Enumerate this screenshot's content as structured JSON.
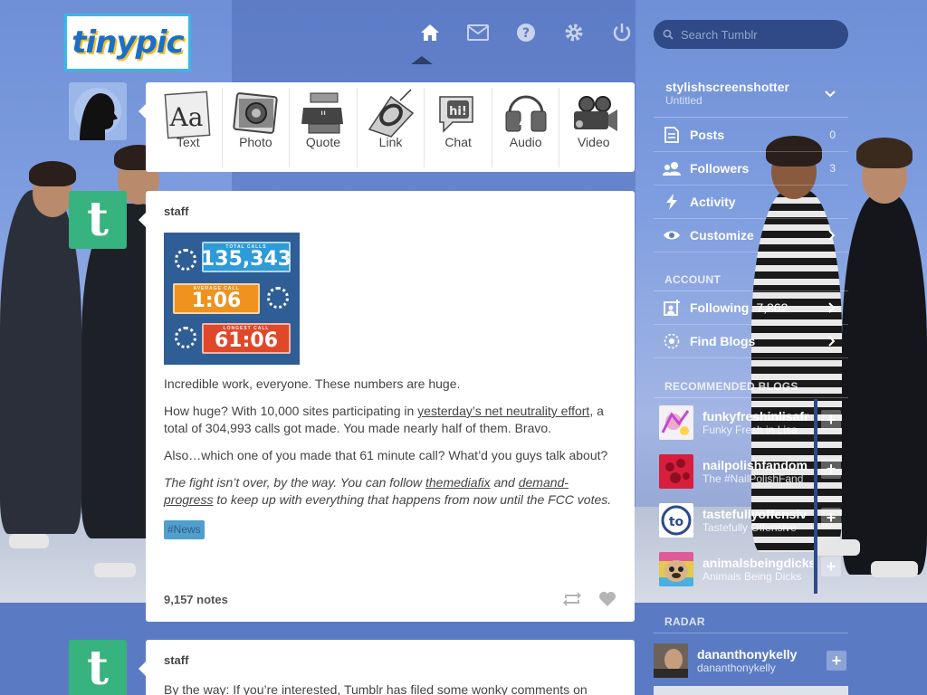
{
  "header": {
    "logo": "tinypic",
    "search_placeholder": "Search Tumblr",
    "nav": [
      "home-icon",
      "inbox-icon",
      "help-icon",
      "settings-icon",
      "logout-icon"
    ]
  },
  "postbox": {
    "items": [
      {
        "label": "Text",
        "icon": "text-icon"
      },
      {
        "label": "Photo",
        "icon": "photo-icon"
      },
      {
        "label": "Quote",
        "icon": "quote-icon"
      },
      {
        "label": "Link",
        "icon": "link-icon"
      },
      {
        "label": "Chat",
        "icon": "chat-icon"
      },
      {
        "label": "Audio",
        "icon": "audio-icon"
      },
      {
        "label": "Video",
        "icon": "video-icon"
      }
    ]
  },
  "post1": {
    "author": "staff",
    "image": {
      "total_label": "TOTAL CALLS",
      "total_value": "135,343",
      "average_label": "AVERAGE CALL",
      "average_value": "1:06",
      "longest_label": "LONGEST CALL",
      "longest_value": "61:06"
    },
    "p1": "Incredible work, everyone. These numbers are huge.",
    "p2_a": "How huge? With 10,000 sites participating in ",
    "p2_link": "yesterday’s net neutrality effort",
    "p2_b": ", a total of 304,993 calls got made. You made nearly half of them. Bravo.",
    "p3": "Also…which one of you made that 61 minute call? What’d you guys talk about?",
    "p4_a": "The fight isn’t over, by the way. You can follow ",
    "p4_link1": "themediafix",
    "p4_b": " and ",
    "p4_link2": "demand-progress",
    "p4_c": " to keep up with everything that happens from now until the FCC votes.",
    "tag": "#News",
    "notes": "9,157 notes"
  },
  "post2": {
    "author": "staff",
    "text": "By the way: If you’re interested, Tumblr has filed some wonky comments on"
  },
  "sidebar": {
    "blog_name": "stylishscreenshotter",
    "blog_title": "Untitled",
    "menu": [
      {
        "label": "Posts",
        "count": "0",
        "icon": "posts-icon"
      },
      {
        "label": "Followers",
        "count": "3",
        "icon": "followers-icon"
      },
      {
        "label": "Activity",
        "count": "",
        "icon": "activity-icon"
      },
      {
        "label": "Customize",
        "count": "",
        "icon": "customize-icon"
      }
    ],
    "account_title": "ACCOUNT",
    "account_menu": [
      {
        "label": "Following",
        "count": "7,862",
        "icon": "following-icon"
      },
      {
        "label": "Find Blogs",
        "icon": "find-blogs-icon"
      }
    ],
    "recommended_title": "RECOMMENDED BLOGS",
    "recommended": [
      {
        "name": "funkyfreshinlisafr",
        "sub": "Funky Fresh in Lisa"
      },
      {
        "name": "nailpolishfandom",
        "sub": "The #NailPolishFand"
      },
      {
        "name": "tastefullyoffensiv",
        "sub": "Tastefully Offensive"
      },
      {
        "name": "animalsbeingdicks",
        "sub": "Animals Being Dicks"
      }
    ],
    "radar_title": "RADAR",
    "radar": {
      "name": "dananthonykelly",
      "sub": "dananthonykelly"
    }
  },
  "colors": {
    "tumblr_blue": "#36465d",
    "staff_green": "#36b37e",
    "tag_blue": "#529ecc"
  }
}
